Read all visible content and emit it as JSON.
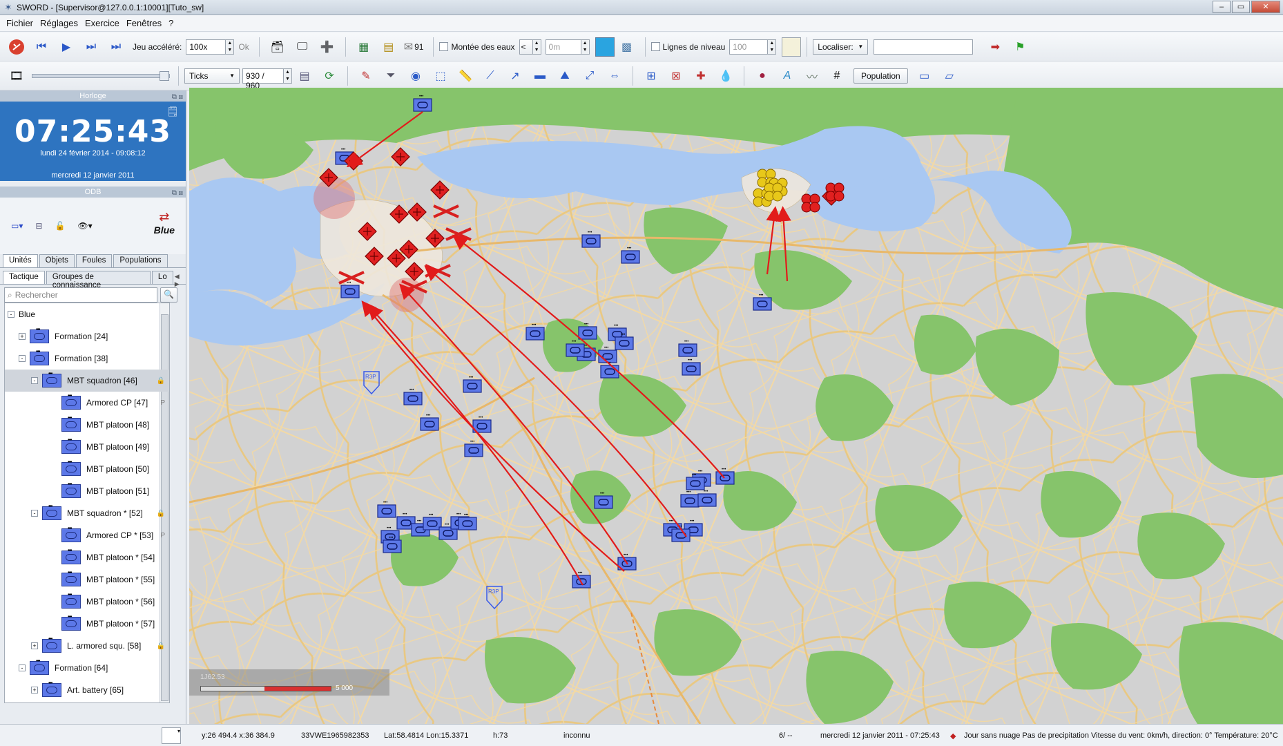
{
  "window": {
    "title": "SWORD - [Supervisor@127.0.0.1:10001][Tuto_sw]"
  },
  "menu": [
    "Fichier",
    "Réglages",
    "Exercice",
    "Fenêtres",
    "?"
  ],
  "toolbar1": {
    "speed_label": "Jeu accéléré:",
    "speed_value": "100x",
    "ok_label": "Ok",
    "messages_count": "91",
    "flood_label": "Montée des eaux",
    "flood_dir": "<",
    "flood_value": "0m",
    "contour_label": "Lignes de niveau",
    "contour_value": "100",
    "locate_label": "Localiser:",
    "locate_value": ""
  },
  "toolbar2": {
    "ticks_label": "Ticks",
    "tick_value": "930 / 960",
    "population_label": "Population"
  },
  "clock": {
    "title": "Horloge",
    "time": "07:25:43",
    "real_date": "lundi 24 février 2014 - 09:08:12",
    "sim_date": "mercredi 12 janvier 2011"
  },
  "odb": {
    "title": "ODB",
    "side_label": "Blue"
  },
  "tabs": [
    "Unités",
    "Objets",
    "Foules",
    "Populations"
  ],
  "subtabs": [
    "Tactique",
    "Groupes de connaissance",
    "Lo"
  ],
  "search_placeholder": "Rechercher",
  "tree": [
    {
      "label": "Blue",
      "level": 0,
      "exp": "-",
      "icon": false
    },
    {
      "label": "Formation [24]",
      "level": 1,
      "exp": "+",
      "icon": true
    },
    {
      "label": "Formation [38]",
      "level": 1,
      "exp": "-",
      "icon": true
    },
    {
      "label": "MBT squadron [46]",
      "level": 2,
      "exp": "-",
      "icon": true,
      "sel": true,
      "lock": true
    },
    {
      "label": "Armored CP [47]",
      "level": 3,
      "icon": true,
      "flag": "P"
    },
    {
      "label": "MBT platoon [48]",
      "level": 3,
      "icon": true
    },
    {
      "label": "MBT platoon [49]",
      "level": 3,
      "icon": true
    },
    {
      "label": "MBT platoon [50]",
      "level": 3,
      "icon": true
    },
    {
      "label": "MBT platoon [51]",
      "level": 3,
      "icon": true
    },
    {
      "label": "MBT squadron * [52]",
      "level": 2,
      "exp": "-",
      "icon": true,
      "lock": true
    },
    {
      "label": "Armored CP * [53]",
      "level": 3,
      "icon": true,
      "flag": "P"
    },
    {
      "label": "MBT platoon * [54]",
      "level": 3,
      "icon": true
    },
    {
      "label": "MBT platoon * [55]",
      "level": 3,
      "icon": true
    },
    {
      "label": "MBT platoon * [56]",
      "level": 3,
      "icon": true
    },
    {
      "label": "MBT platoon * [57]",
      "level": 3,
      "icon": true
    },
    {
      "label": "L. armored squ. [58]",
      "level": 2,
      "exp": "+",
      "icon": true,
      "lock": true
    },
    {
      "label": "Formation [64]",
      "level": 1,
      "exp": "-",
      "icon": true
    },
    {
      "label": "Art. battery [65]",
      "level": 2,
      "exp": "+",
      "icon": true
    }
  ],
  "map": {
    "scale_label": "5 000",
    "coord_overlay": "1J62.53",
    "phase_line_label": "R3P",
    "colors": {
      "water": "#a9c8f2",
      "forest": "#86c46b",
      "land": "#d2d2d2",
      "road": "#f3d9a4",
      "friend": "#5c78e8",
      "enemy": "#e02020",
      "neutral": "#e8c81a",
      "arrow": "#e21b1b"
    }
  },
  "status": {
    "xy": "y:26 494.4 x:36 384.9",
    "mgrs": "33VWE1965982353",
    "latlon": "Lat:58.4814 Lon:15.3371",
    "height": "h:73",
    "terrain": "inconnu",
    "page": "6/ --",
    "datetime": "mercredi 12 janvier 2011 - 07:25:43",
    "weather": "Jour sans nuage  Pas de precipitation  Vitesse du vent: 0km/h, direction: 0°  Température: 20°C"
  }
}
